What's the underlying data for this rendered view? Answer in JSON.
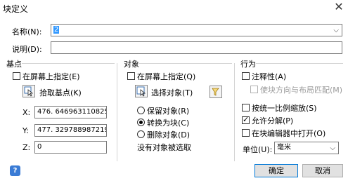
{
  "dialog": {
    "title": "块定义",
    "close_glyph": "✕"
  },
  "name_field": {
    "label": "名称(N):",
    "value": "2",
    "dropdown_glyph": "⌵"
  },
  "description_field": {
    "label": "说明(D):",
    "value": ""
  },
  "base_point": {
    "header": "基点",
    "specify_on_screen_label": "在屏幕上指定(E)",
    "specify_on_screen_checked": false,
    "pick_point_label": "拾取基点(K)",
    "x_label": "X:",
    "x_value": "476. 6469631108255",
    "y_label": "Y:",
    "y_value": "477. 3297889872194",
    "z_label": "Z:",
    "z_value": "0"
  },
  "objects": {
    "header": "对象",
    "specify_on_screen_label": "在屏幕上指定(Q)",
    "specify_on_screen_checked": false,
    "select_objects_label": "选择对象(T)",
    "retain_label": "保留对象(R)",
    "convert_label": "转换为块(C)",
    "delete_label": "删除对象(D)",
    "selected_option": "convert",
    "status_text": "没有对象被选取"
  },
  "behavior": {
    "header": "行为",
    "annotative_label": "注释性(A)",
    "annotative_checked": false,
    "match_orientation_label": "使块方向与布局匹配(M)",
    "match_orientation_checked": false,
    "uniform_scale_label": "按统一比例缩放(S)",
    "uniform_scale_checked": false,
    "allow_explode_label": "允许分解(P)",
    "allow_explode_checked": true,
    "open_in_editor_label": "在块编辑器中打开(O)",
    "open_in_editor_checked": false,
    "unit_label": "单位(U):",
    "unit_value": "毫米"
  },
  "footer": {
    "help_glyph": "?",
    "ok_label": "确定",
    "cancel_label": "取消"
  },
  "colors": {
    "accent": "#0078d7",
    "help_icon": "#3a7bd5",
    "selection": "#3399ff"
  }
}
